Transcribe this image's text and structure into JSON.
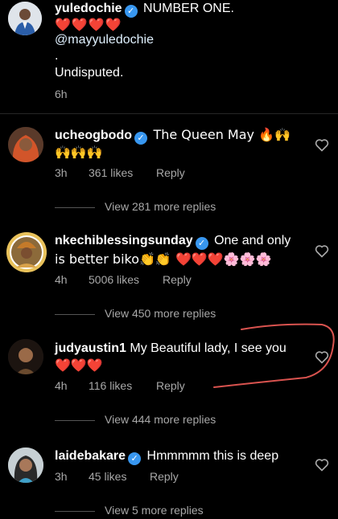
{
  "post": {
    "username": "yuledochie",
    "caption_line1": "NUMBER ONE.",
    "caption_hearts": "❤️❤️❤️❤️",
    "mention": "@mayyuledochie",
    "dot": ".",
    "caption_line3": "Undisputed.",
    "time": "6h"
  },
  "comments": [
    {
      "username": "ucheogbodo",
      "text": "The Queen May 🔥🙌",
      "text2": "🙌🙌🙌",
      "time": "3h",
      "likes": "361 likes",
      "reply": "Reply",
      "view_more": "View 281 more replies"
    },
    {
      "username": "nkechiblessingsunday",
      "text": "One and only",
      "text2": "is better biko👏👏 ❤️❤️❤️🌸🌸🌸",
      "time": "4h",
      "likes": "5006 likes",
      "reply": "Reply",
      "view_more": "View 450 more replies"
    },
    {
      "username": "judyaustin1",
      "text": "My Beautiful lady, I see you",
      "text2": "❤️❤️❤️",
      "time": "4h",
      "likes": "116 likes",
      "reply": "Reply",
      "view_more": "View 444 more replies"
    },
    {
      "username": "laidebakare",
      "text": "Hmmmmm this is deep",
      "time": "3h",
      "likes": "45 likes",
      "reply": "Reply",
      "view_more": "View 5 more replies"
    }
  ],
  "icons": {
    "verified": "verified-badge-icon",
    "like": "heart-outline-icon"
  },
  "colors": {
    "verified": "#3897f0",
    "annotation": "#d9534f",
    "muted": "#a8a8a8"
  }
}
